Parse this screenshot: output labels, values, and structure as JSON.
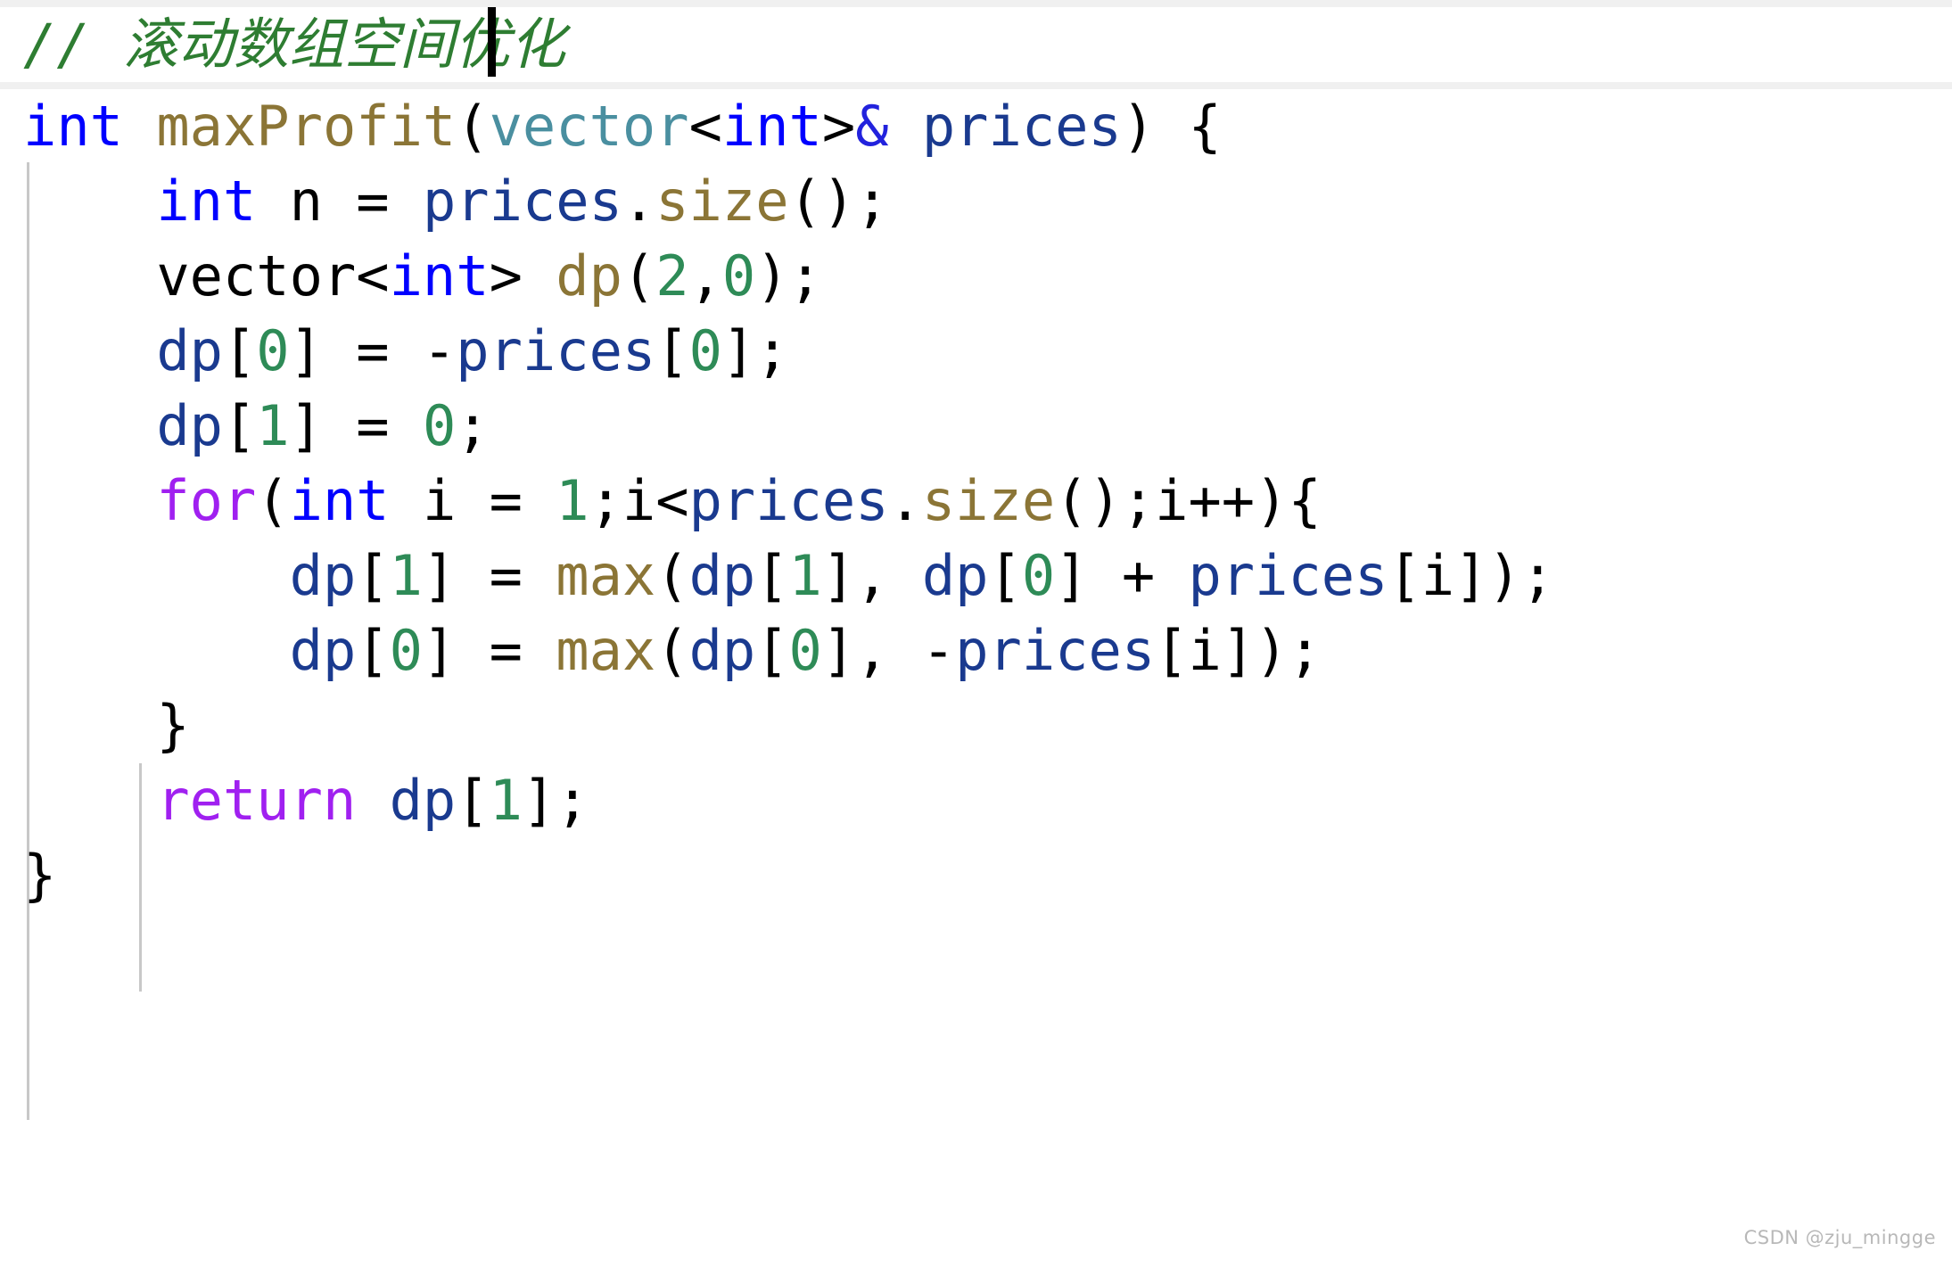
{
  "editor": {
    "language": "cpp",
    "background_color": "#ffffff",
    "current_line_highlight_color": "#f0f0f0",
    "indent_guide_color": "#c8c8c8",
    "caret_color": "#000000"
  },
  "palette": {
    "comment": "#2e7d32",
    "keyword": "#0000ff",
    "control_keyword": "#a020f0",
    "function": "#8b7536",
    "type": "#4a8fa0",
    "variable": "#1a3a8f",
    "number": "#2e8b57",
    "punctuation": "#000000",
    "reference_amp": "#2222dd"
  },
  "code": {
    "lines": [
      {
        "id": "line-comment",
        "plain": "// 滚动数组空间优化",
        "tokens": [
          {
            "t": "// ",
            "c": "comment"
          },
          {
            "t": "滚动数组空间优化",
            "c": "comment"
          }
        ]
      },
      {
        "id": "line-signature",
        "plain": "int maxProfit(vector<int>& prices) {",
        "tokens": [
          {
            "t": "int",
            "c": "keyword"
          },
          {
            "t": " ",
            "c": "plain"
          },
          {
            "t": "maxProfit",
            "c": "func"
          },
          {
            "t": "(",
            "c": "punct"
          },
          {
            "t": "vector",
            "c": "type"
          },
          {
            "t": "<",
            "c": "punct"
          },
          {
            "t": "int",
            "c": "keyword"
          },
          {
            "t": ">",
            "c": "punct"
          },
          {
            "t": "&",
            "c": "amp"
          },
          {
            "t": " ",
            "c": "plain"
          },
          {
            "t": "prices",
            "c": "var"
          },
          {
            "t": ")",
            "c": "punct"
          },
          {
            "t": " ",
            "c": "plain"
          },
          {
            "t": "{",
            "c": "punct"
          }
        ]
      },
      {
        "id": "line-size",
        "plain": "    int n = prices.size();",
        "tokens": [
          {
            "t": "    ",
            "c": "plain"
          },
          {
            "t": "int",
            "c": "keyword"
          },
          {
            "t": " ",
            "c": "plain"
          },
          {
            "t": "n",
            "c": "plain"
          },
          {
            "t": " ",
            "c": "plain"
          },
          {
            "t": "=",
            "c": "op"
          },
          {
            "t": " ",
            "c": "plain"
          },
          {
            "t": "prices",
            "c": "var"
          },
          {
            "t": ".",
            "c": "punct"
          },
          {
            "t": "size",
            "c": "func"
          },
          {
            "t": "();",
            "c": "punct"
          }
        ]
      },
      {
        "id": "line-dp-decl",
        "plain": "    vector<int> dp(2,0);",
        "tokens": [
          {
            "t": "    ",
            "c": "plain"
          },
          {
            "t": "vector",
            "c": "plain"
          },
          {
            "t": "<",
            "c": "punct"
          },
          {
            "t": "int",
            "c": "keyword"
          },
          {
            "t": ">",
            "c": "punct"
          },
          {
            "t": " ",
            "c": "plain"
          },
          {
            "t": "dp",
            "c": "func"
          },
          {
            "t": "(",
            "c": "punct"
          },
          {
            "t": "2",
            "c": "number"
          },
          {
            "t": ",",
            "c": "punct"
          },
          {
            "t": "0",
            "c": "number"
          },
          {
            "t": ");",
            "c": "punct"
          }
        ]
      },
      {
        "id": "line-dp0-init",
        "plain": "    dp[0] = -prices[0];",
        "tokens": [
          {
            "t": "    ",
            "c": "plain"
          },
          {
            "t": "dp",
            "c": "var"
          },
          {
            "t": "[",
            "c": "punct"
          },
          {
            "t": "0",
            "c": "number"
          },
          {
            "t": "]",
            "c": "punct"
          },
          {
            "t": " ",
            "c": "plain"
          },
          {
            "t": "=",
            "c": "op"
          },
          {
            "t": " ",
            "c": "plain"
          },
          {
            "t": "-",
            "c": "op"
          },
          {
            "t": "prices",
            "c": "var"
          },
          {
            "t": "[",
            "c": "punct"
          },
          {
            "t": "0",
            "c": "number"
          },
          {
            "t": "];",
            "c": "punct"
          }
        ]
      },
      {
        "id": "line-dp1-init",
        "plain": "    dp[1] = 0;",
        "tokens": [
          {
            "t": "    ",
            "c": "plain"
          },
          {
            "t": "dp",
            "c": "var"
          },
          {
            "t": "[",
            "c": "punct"
          },
          {
            "t": "1",
            "c": "number"
          },
          {
            "t": "]",
            "c": "punct"
          },
          {
            "t": " ",
            "c": "plain"
          },
          {
            "t": "=",
            "c": "op"
          },
          {
            "t": " ",
            "c": "plain"
          },
          {
            "t": "0",
            "c": "number"
          },
          {
            "t": ";",
            "c": "punct"
          }
        ]
      },
      {
        "id": "line-for",
        "plain": "    for(int i = 1;i<prices.size();i++){",
        "tokens": [
          {
            "t": "    ",
            "c": "plain"
          },
          {
            "t": "for",
            "c": "control"
          },
          {
            "t": "(",
            "c": "punct"
          },
          {
            "t": "int",
            "c": "keyword"
          },
          {
            "t": " ",
            "c": "plain"
          },
          {
            "t": "i",
            "c": "plain"
          },
          {
            "t": " ",
            "c": "plain"
          },
          {
            "t": "=",
            "c": "op"
          },
          {
            "t": " ",
            "c": "plain"
          },
          {
            "t": "1",
            "c": "number"
          },
          {
            "t": ";",
            "c": "punct"
          },
          {
            "t": "i",
            "c": "plain"
          },
          {
            "t": "<",
            "c": "op"
          },
          {
            "t": "prices",
            "c": "var"
          },
          {
            "t": ".",
            "c": "punct"
          },
          {
            "t": "size",
            "c": "func"
          },
          {
            "t": "();",
            "c": "punct"
          },
          {
            "t": "i",
            "c": "plain"
          },
          {
            "t": "++){",
            "c": "punct"
          }
        ]
      },
      {
        "id": "line-dp1-update",
        "plain": "        dp[1] = max(dp[1], dp[0] + prices[i]);",
        "tokens": [
          {
            "t": "        ",
            "c": "plain"
          },
          {
            "t": "dp",
            "c": "var"
          },
          {
            "t": "[",
            "c": "punct"
          },
          {
            "t": "1",
            "c": "number"
          },
          {
            "t": "]",
            "c": "punct"
          },
          {
            "t": " ",
            "c": "plain"
          },
          {
            "t": "=",
            "c": "op"
          },
          {
            "t": " ",
            "c": "plain"
          },
          {
            "t": "max",
            "c": "func"
          },
          {
            "t": "(",
            "c": "punct"
          },
          {
            "t": "dp",
            "c": "var"
          },
          {
            "t": "[",
            "c": "punct"
          },
          {
            "t": "1",
            "c": "number"
          },
          {
            "t": "], ",
            "c": "punct"
          },
          {
            "t": "dp",
            "c": "var"
          },
          {
            "t": "[",
            "c": "punct"
          },
          {
            "t": "0",
            "c": "number"
          },
          {
            "t": "]",
            "c": "punct"
          },
          {
            "t": " ",
            "c": "plain"
          },
          {
            "t": "+",
            "c": "op"
          },
          {
            "t": " ",
            "c": "plain"
          },
          {
            "t": "prices",
            "c": "var"
          },
          {
            "t": "[",
            "c": "punct"
          },
          {
            "t": "i",
            "c": "plain"
          },
          {
            "t": "]);",
            "c": "punct"
          }
        ]
      },
      {
        "id": "line-dp0-update",
        "plain": "        dp[0] = max(dp[0], -prices[i]);",
        "tokens": [
          {
            "t": "        ",
            "c": "plain"
          },
          {
            "t": "dp",
            "c": "var"
          },
          {
            "t": "[",
            "c": "punct"
          },
          {
            "t": "0",
            "c": "number"
          },
          {
            "t": "]",
            "c": "punct"
          },
          {
            "t": " ",
            "c": "plain"
          },
          {
            "t": "=",
            "c": "op"
          },
          {
            "t": " ",
            "c": "plain"
          },
          {
            "t": "max",
            "c": "func"
          },
          {
            "t": "(",
            "c": "punct"
          },
          {
            "t": "dp",
            "c": "var"
          },
          {
            "t": "[",
            "c": "punct"
          },
          {
            "t": "0",
            "c": "number"
          },
          {
            "t": "], ",
            "c": "punct"
          },
          {
            "t": "-",
            "c": "op"
          },
          {
            "t": "prices",
            "c": "var"
          },
          {
            "t": "[",
            "c": "punct"
          },
          {
            "t": "i",
            "c": "plain"
          },
          {
            "t": "]);",
            "c": "punct"
          }
        ]
      },
      {
        "id": "line-for-close",
        "plain": "    }",
        "tokens": [
          {
            "t": "    ",
            "c": "plain"
          },
          {
            "t": "}",
            "c": "punct"
          }
        ]
      },
      {
        "id": "line-return",
        "plain": "    return dp[1];",
        "tokens": [
          {
            "t": "    ",
            "c": "plain"
          },
          {
            "t": "return",
            "c": "control"
          },
          {
            "t": " ",
            "c": "plain"
          },
          {
            "t": "dp",
            "c": "var"
          },
          {
            "t": "[",
            "c": "punct"
          },
          {
            "t": "1",
            "c": "number"
          },
          {
            "t": "];",
            "c": "punct"
          }
        ]
      },
      {
        "id": "line-func-close",
        "plain": "}",
        "tokens": [
          {
            "t": "}",
            "c": "punct"
          }
        ]
      }
    ]
  },
  "watermark": {
    "text": "CSDN @zju_mingge"
  }
}
